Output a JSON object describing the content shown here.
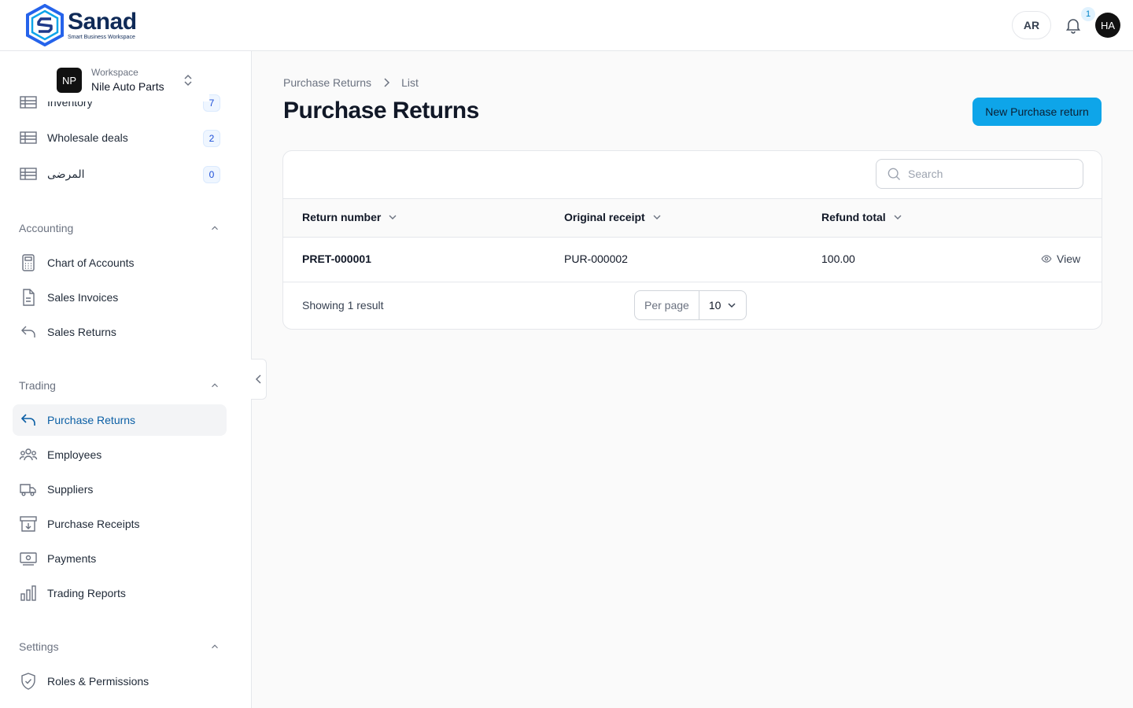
{
  "brand": {
    "name": "Sanad",
    "tagline": "Smart Business Workspace"
  },
  "header": {
    "language": "AR",
    "notifications_count": "1",
    "user_initials": "HA"
  },
  "workspace": {
    "initials": "NP",
    "label": "Workspace",
    "name": "Nile Auto Parts"
  },
  "sidebar": {
    "top_items": [
      {
        "label": "Inventory",
        "badge": "7",
        "icon": "table-icon"
      },
      {
        "label": "Wholesale deals",
        "badge": "2",
        "icon": "table-icon"
      },
      {
        "label": "المرضى",
        "badge": "0",
        "icon": "table-icon"
      }
    ],
    "groups": [
      {
        "title": "Accounting",
        "items": [
          {
            "label": "Chart of Accounts",
            "icon": "calculator-icon"
          },
          {
            "label": "Sales Invoices",
            "icon": "document-icon"
          },
          {
            "label": "Sales Returns",
            "icon": "undo-arrow-icon"
          }
        ]
      },
      {
        "title": "Trading",
        "items": [
          {
            "label": "Purchase Returns",
            "icon": "undo-arrow-icon",
            "active": true
          },
          {
            "label": "Employees",
            "icon": "users-icon"
          },
          {
            "label": "Suppliers",
            "icon": "truck-icon"
          },
          {
            "label": "Purchase Receipts",
            "icon": "archive-down-icon"
          },
          {
            "label": "Payments",
            "icon": "banknote-icon"
          },
          {
            "label": "Trading Reports",
            "icon": "bar-chart-icon"
          }
        ]
      },
      {
        "title": "Settings",
        "items": [
          {
            "label": "Roles & Permissions",
            "icon": "shield-check-icon"
          }
        ]
      }
    ]
  },
  "breadcrumb": {
    "parent": "Purchase Returns",
    "current": "List"
  },
  "page": {
    "title": "Purchase Returns",
    "new_button": "New Purchase return"
  },
  "table": {
    "search_placeholder": "Search",
    "columns": [
      "Return number",
      "Original receipt",
      "Refund total"
    ],
    "rows": [
      {
        "return_number": "PRET-000001",
        "original_receipt": "PUR-000002",
        "refund_total": "100.00",
        "action": "View"
      }
    ],
    "footer": {
      "showing": "Showing 1 result",
      "per_page_label": "Per page",
      "per_page_value": "10"
    }
  },
  "colors": {
    "accent": "#0ea5e9",
    "brand": "#0f2a57",
    "active_text": "#0b5fa5"
  }
}
